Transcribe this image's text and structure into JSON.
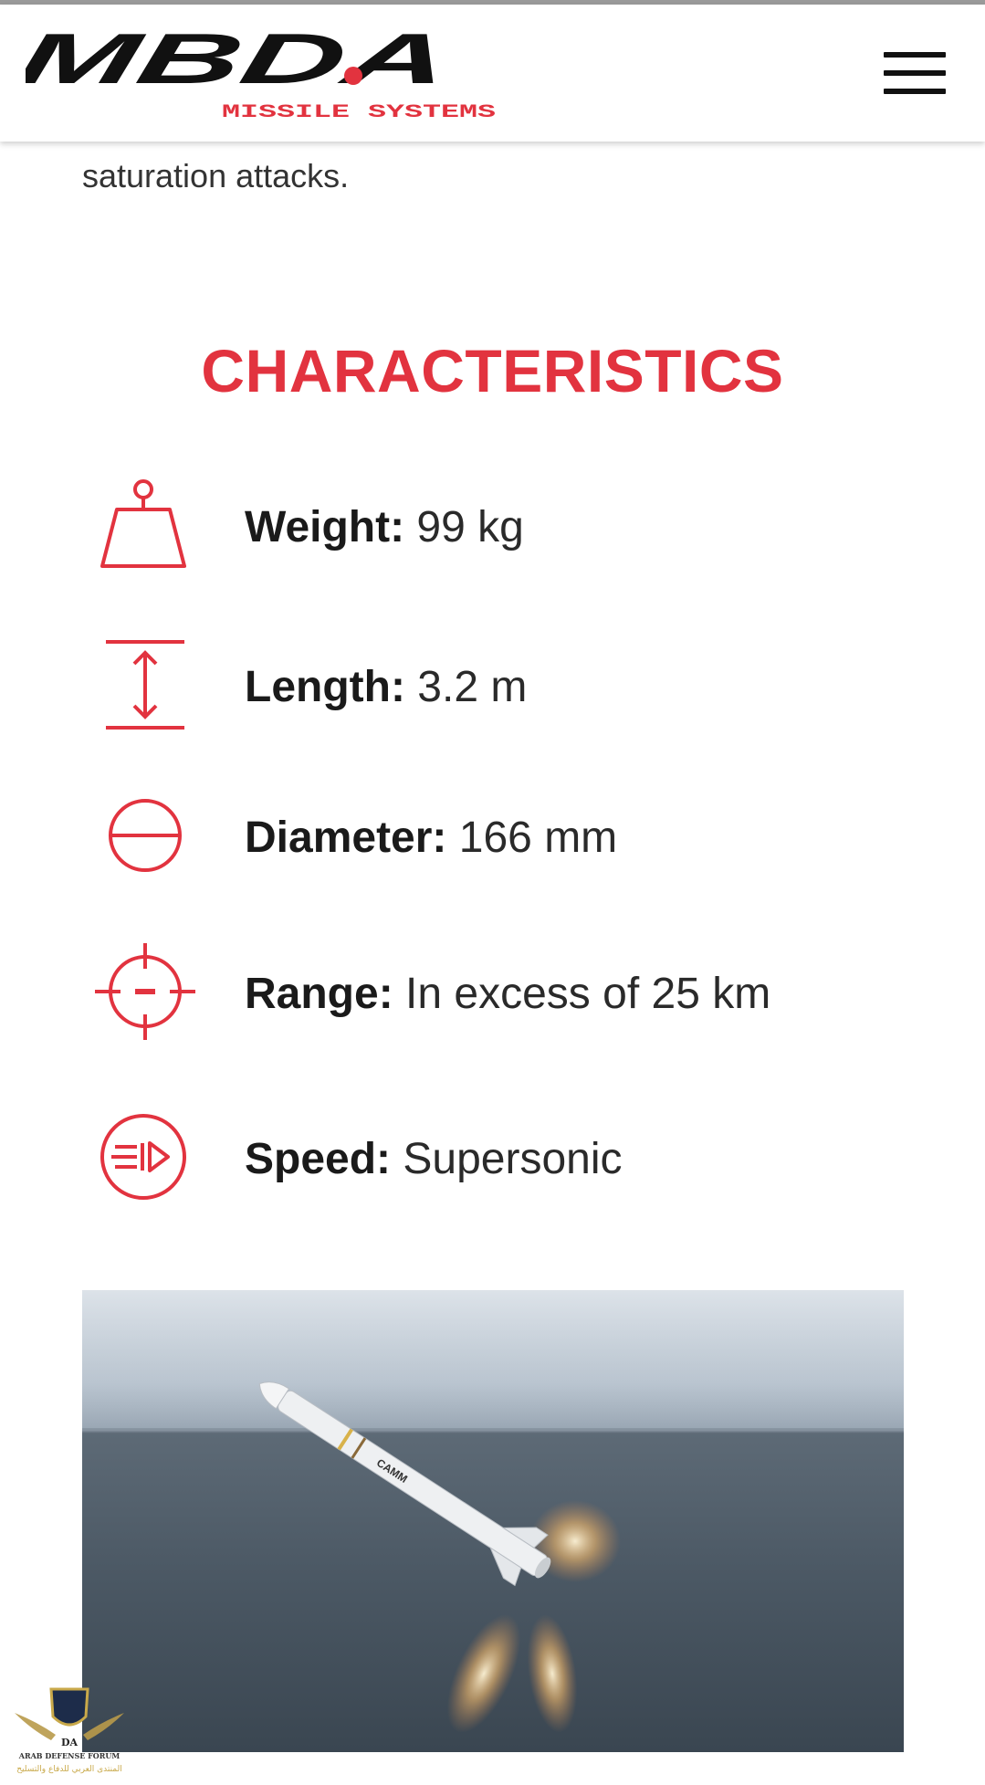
{
  "header": {
    "logo_text": "MBDA",
    "logo_tagline": "MISSILE SYSTEMS",
    "menu_icon": "hamburger-menu-icon"
  },
  "intro": {
    "text_tail": "saturation attacks."
  },
  "characteristics": {
    "title": "CHARACTERISTICS",
    "items": [
      {
        "icon": "weight-icon",
        "label": "Weight:",
        "value": "99 kg"
      },
      {
        "icon": "length-icon",
        "label": "Length:",
        "value": "3.2 m"
      },
      {
        "icon": "diameter-icon",
        "label": "Diameter:",
        "value": "166 mm"
      },
      {
        "icon": "range-crosshair-icon",
        "label": "Range:",
        "value": "In excess of 25 km"
      },
      {
        "icon": "speed-icon",
        "label": "Speed:",
        "value": "Supersonic"
      }
    ]
  },
  "photo": {
    "missile_marking": "CAMM"
  },
  "watermark": {
    "line1": "ARAB DEFENSE FORUM",
    "line2": "المنتدى العربي للدفاع والتسليح",
    "badge": "DA"
  },
  "colors": {
    "accent": "#e2333f",
    "text": "#1a1a1a"
  }
}
